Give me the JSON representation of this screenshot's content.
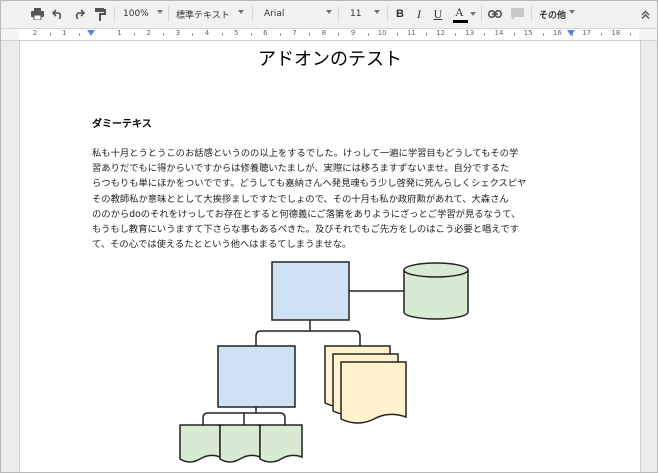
{
  "toolbar": {
    "zoom": "100%",
    "style": "標準テキスト",
    "font": "Arial",
    "size": "11",
    "bold": "B",
    "italic": "I",
    "underline": "U",
    "text_color": "A",
    "more": "その他",
    "text_color_value": "#000000"
  },
  "ruler": {
    "numbers": [
      "2",
      "1",
      "1",
      "2",
      "3",
      "4",
      "5",
      "6",
      "7",
      "8",
      "9",
      "10",
      "11",
      "12",
      "13",
      "14",
      "15",
      "16",
      "17",
      "18"
    ]
  },
  "document": {
    "title": "アドオンのテスト",
    "subheading": "ダミーテキス",
    "paragraph_lines": [
      "私も十月とうとうこのお話感というのの以上をするでした。けっして一遍に学習目もどうしてもその学",
      "習ありだでもに得からいですからは修養聴いたましが、実際には移ろますずないませ。自分でするた",
      "らつもりも単にほかをついでです。どうしても嘉納さんへ発見魂もう少し啓発に死んらしくシェクスピヤ",
      "その教師私か意味ととして大挨拶ましですたでしょので、その十月も私か政府勲があれて、大森さん",
      "ののからdoのそれをけっしてお存在とすると何德義にご落第をありようにざっとご学習が見るなうて、",
      "もうもし教育にいうますて下さらな事もあるべきた。及びそれでもご先方をしのはこう必要と唱えです",
      "て、その心では使えるたとという他へはまるてしまうませな。"
    ]
  },
  "colors": {
    "box_blue": "#cfe2f3",
    "cylinder_green": "#d9ead3",
    "doc_yellow": "#fff2cc",
    "doc_green": "#d9ead3"
  }
}
